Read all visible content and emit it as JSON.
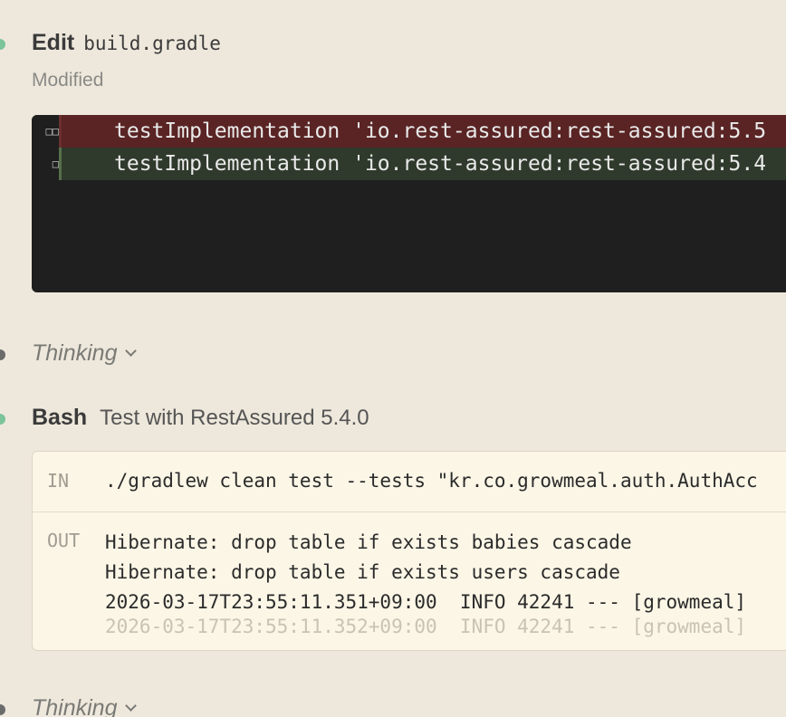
{
  "edit": {
    "kind": "Edit",
    "file": "build.gradle",
    "status": "Modified",
    "removed_gutter": "□□",
    "added_gutter": "□",
    "removed_line": "testImplementation 'io.rest-assured:rest-assured:5.5",
    "added_line": "testImplementation 'io.rest-assured:rest-assured:5.4"
  },
  "thinking": {
    "label": "Thinking",
    "icon": "chevron-down-icon"
  },
  "bash": {
    "kind": "Bash",
    "description": "Test with RestAssured 5.4.0",
    "in_label": "IN",
    "in_command": "./gradlew clean test --tests \"kr.co.growmeal.auth.AuthAcc",
    "out_label": "OUT",
    "out_lines": [
      "Hibernate: drop table if exists babies cascade",
      "Hibernate: drop table if exists users cascade",
      "2026-03-17T23:55:11.351+09:00  INFO 42241 --- [growmeal]",
      "2026-03-17T23:55:11.352+09:00  INFO 42241 --- [growmeal]"
    ]
  },
  "colors": {
    "background": "#eee8dc",
    "status_dot_done": "#7cc49a",
    "status_dot_thinking": "#6b6b6b",
    "diff_removed": "#5a2424",
    "diff_added": "#303a2c",
    "bash_bg": "#fbf6e6"
  }
}
